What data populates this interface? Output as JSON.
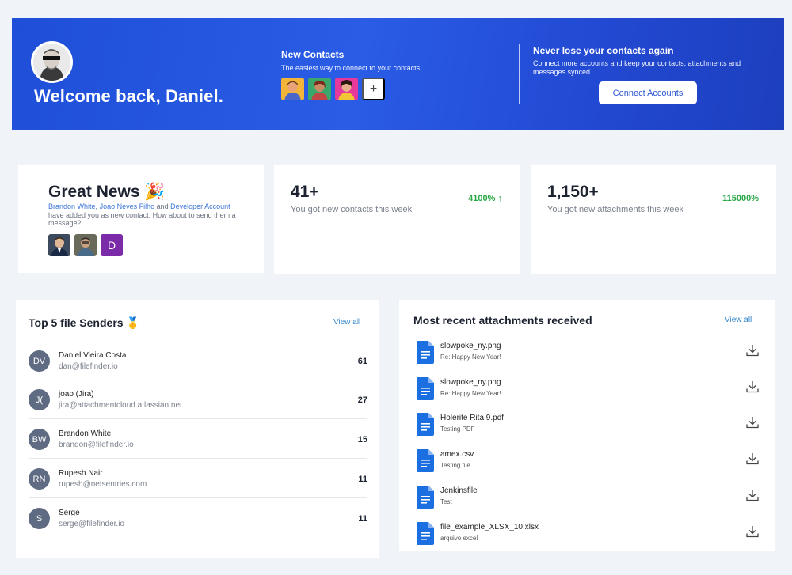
{
  "banner": {
    "welcome": "Welcome back, Daniel.",
    "new_contacts": {
      "title": "New Contacts",
      "subtitle": "The easiest way to connect to your contacts",
      "add_label": "+"
    },
    "never_lose": {
      "title": "Never lose your contacts again",
      "subtitle": "Connect more accounts and keep your contacts, attachments and messages synced."
    },
    "connect_button": "Connect Accounts"
  },
  "great_news": {
    "title": "Great News 🎉",
    "link1": "Brandon White",
    "sep1": ", ",
    "link2": "Joao Neves Filho",
    "and": " and ",
    "link3": "Developer Account",
    "rest": " have added you as new contact. How about to send them a message?",
    "avatar3_initial": "D"
  },
  "stats": [
    {
      "number": "41+",
      "label": "You got new contacts this week",
      "pct": "4100%",
      "arrow": " ↑"
    },
    {
      "number": "1,150+",
      "label": "You got new attachments this week",
      "pct": "115000%",
      "arrow": ""
    }
  ],
  "senders": {
    "title": "Top 5 file Senders 🥇",
    "view_all": "View all",
    "rows": [
      {
        "initials": "DV",
        "name": "Daniel Vieira Costa",
        "email": "dan@filefinder.io",
        "count": "61"
      },
      {
        "initials": "J(",
        "name": "joao (Jira)",
        "email": "jira@attachmentcloud.atlassian.net",
        "count": "27"
      },
      {
        "initials": "BW",
        "name": "Brandon White",
        "email": "brandon@filefinder.io",
        "count": "15"
      },
      {
        "initials": "RN",
        "name": "Rupesh Nair",
        "email": "rupesh@netsentries.com",
        "count": "11"
      },
      {
        "initials": "S",
        "name": "Serge",
        "email": "serge@filefinder.io",
        "count": "11"
      }
    ]
  },
  "attachments": {
    "title": "Most recent attachments received",
    "view_all": "View all",
    "rows": [
      {
        "name": "slowpoke_ny.png",
        "subject": "Re: Happy New Year!"
      },
      {
        "name": "slowpoke_ny.png",
        "subject": "Re: Happy New Year!"
      },
      {
        "name": "Holerite Rita 9.pdf",
        "subject": "Testing PDF"
      },
      {
        "name": "amex.csv",
        "subject": "Testing file"
      },
      {
        "name": "Jenkinsfile",
        "subject": "Test"
      },
      {
        "name": "file_example_XLSX_10.xlsx",
        "subject": "arquivo excel"
      }
    ]
  },
  "colors": {
    "banner": "#2454dc",
    "accent_link": "#2f84c9",
    "positive": "#28a745",
    "sender_avatar": "#5f6b82",
    "file_icon": "#1b6fe0"
  }
}
